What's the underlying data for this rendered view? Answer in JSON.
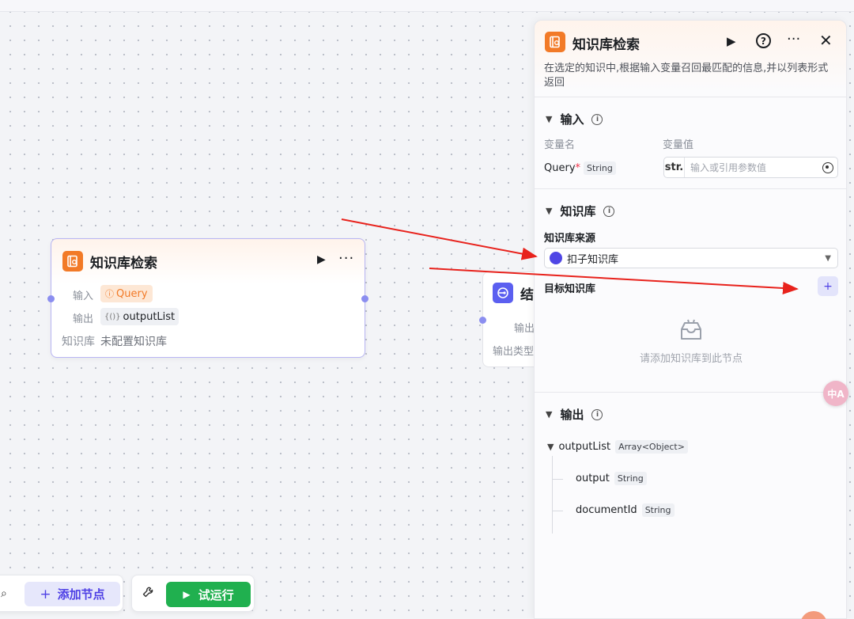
{
  "canvas_node": {
    "title": "知识库检索",
    "input_label": "输入",
    "input_tag": "Query",
    "output_label": "输出",
    "output_tag": "outputList",
    "kb_label": "知识库",
    "kb_value": "未配置知识库"
  },
  "canvas_node2": {
    "title": "结",
    "line1": "输出",
    "line2": "输出类型"
  },
  "toolbar": {
    "add_node": "添加节点",
    "trial_run": "试运行"
  },
  "panel": {
    "title": "知识库检索",
    "description": "在选定的知识中,根据输入变量召回最匹配的信息,并以列表形式返回",
    "input_section": {
      "title": "输入",
      "col_name": "变量名",
      "col_value": "变量值",
      "var_name": "Query",
      "required_mark": "*",
      "var_type": "String",
      "value_prefix": "str.",
      "value_placeholder": "输入或引用参数值"
    },
    "kb_section": {
      "title": "知识库",
      "source_label": "知识库来源",
      "source_value": "扣子知识库",
      "target_label": "目标知识库",
      "add_symbol": "+",
      "empty_text": "请添加知识库到此节点"
    },
    "output_section": {
      "title": "输出",
      "root_name": "outputList",
      "root_type": "Array<Object>",
      "children": [
        {
          "name": "output",
          "type": "String"
        },
        {
          "name": "documentId",
          "type": "String"
        }
      ]
    }
  },
  "translate_badge": "中A",
  "colors": {
    "accent": "#4e40e5",
    "kb_icon": "#f27a27",
    "run_green": "#20b04f",
    "arrow_red": "#e8221c"
  }
}
